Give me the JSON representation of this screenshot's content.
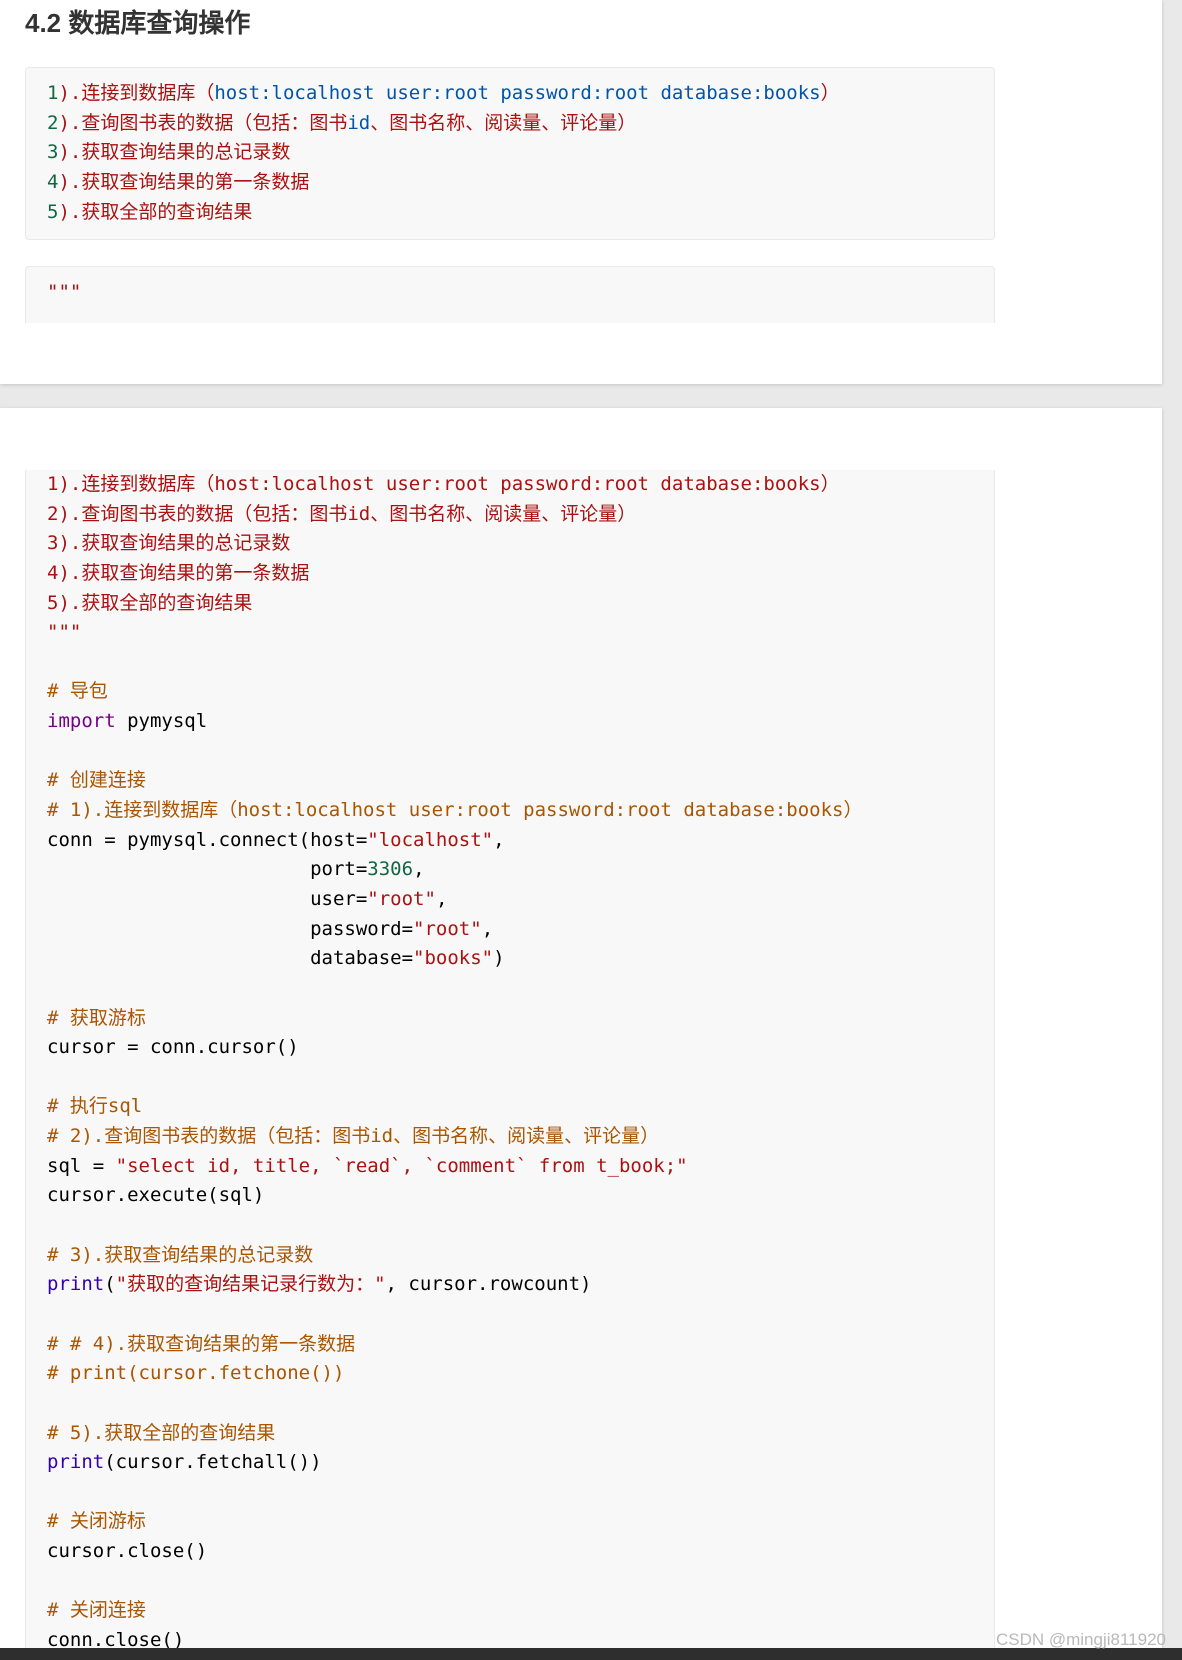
{
  "colors": {
    "number": "#116644",
    "string": "#aa1111",
    "variable2": "#0055aa",
    "comment": "#aa5500",
    "keyword": "#770088",
    "builtin": "#3300aa",
    "text": "#000000"
  },
  "page1": {
    "heading": "4.2 数据库查询操作",
    "requirements_block": [
      [
        {
          "t": "1",
          "c": "number"
        },
        {
          "t": ").连接到数据库（",
          "c": "string"
        },
        {
          "t": "host:localhost user:root password:root database:books",
          "c": "variable2"
        },
        {
          "t": "）",
          "c": "string"
        }
      ],
      [
        {
          "t": "2",
          "c": "number"
        },
        {
          "t": ").查询图书表的数据（包括：图书",
          "c": "string"
        },
        {
          "t": "id",
          "c": "variable2"
        },
        {
          "t": "、图书名称、阅读量、评论量）",
          "c": "string"
        }
      ],
      [
        {
          "t": "3",
          "c": "number"
        },
        {
          "t": ").获取查询结果的总记录数",
          "c": "string"
        }
      ],
      [
        {
          "t": "4",
          "c": "number"
        },
        {
          "t": ").获取查询结果的第一条数据",
          "c": "string"
        }
      ],
      [
        {
          "t": "5",
          "c": "number"
        },
        {
          "t": ").获取全部的查询结果",
          "c": "string"
        }
      ]
    ],
    "docstring_block": [
      [
        {
          "t": "\"\"\"",
          "c": "string"
        }
      ]
    ]
  },
  "page2": {
    "code_block": [
      [
        {
          "t": "1).连接到数据库（host:localhost user:root password:root database:books）",
          "c": "string"
        }
      ],
      [
        {
          "t": "2).查询图书表的数据（包括：图书id、图书名称、阅读量、评论量）",
          "c": "string"
        }
      ],
      [
        {
          "t": "3).获取查询结果的总记录数",
          "c": "string"
        }
      ],
      [
        {
          "t": "4).获取查询结果的第一条数据",
          "c": "string"
        }
      ],
      [
        {
          "t": "5).获取全部的查询结果",
          "c": "string"
        }
      ],
      [
        {
          "t": "\"\"\"",
          "c": "string"
        }
      ],
      [],
      [
        {
          "t": "# 导包",
          "c": "comment"
        }
      ],
      [
        {
          "t": "import",
          "c": "keyword"
        },
        {
          "t": " pymysql",
          "c": "text"
        }
      ],
      [],
      [
        {
          "t": "# 创建连接",
          "c": "comment"
        }
      ],
      [
        {
          "t": "# 1).连接到数据库（host:localhost user:root password:root database:books）",
          "c": "comment"
        }
      ],
      [
        {
          "t": "conn = pymysql.connect(host=",
          "c": "text"
        },
        {
          "t": "\"localhost\"",
          "c": "string"
        },
        {
          "t": ",",
          "c": "text"
        }
      ],
      [
        {
          "t": "                       port=",
          "c": "text"
        },
        {
          "t": "3306",
          "c": "number"
        },
        {
          "t": ",",
          "c": "text"
        }
      ],
      [
        {
          "t": "                       user=",
          "c": "text"
        },
        {
          "t": "\"root\"",
          "c": "string"
        },
        {
          "t": ",",
          "c": "text"
        }
      ],
      [
        {
          "t": "                       password=",
          "c": "text"
        },
        {
          "t": "\"root\"",
          "c": "string"
        },
        {
          "t": ",",
          "c": "text"
        }
      ],
      [
        {
          "t": "                       database=",
          "c": "text"
        },
        {
          "t": "\"books\"",
          "c": "string"
        },
        {
          "t": ")",
          "c": "text"
        }
      ],
      [],
      [
        {
          "t": "# 获取游标",
          "c": "comment"
        }
      ],
      [
        {
          "t": "cursor = conn.cursor()",
          "c": "text"
        }
      ],
      [],
      [
        {
          "t": "# 执行sql",
          "c": "comment"
        }
      ],
      [
        {
          "t": "# 2).查询图书表的数据（包括：图书id、图书名称、阅读量、评论量）",
          "c": "comment"
        }
      ],
      [
        {
          "t": "sql = ",
          "c": "text"
        },
        {
          "t": "\"select id, title, `read`, `comment` from t_book;\"",
          "c": "string"
        }
      ],
      [
        {
          "t": "cursor.execute(sql)",
          "c": "text"
        }
      ],
      [],
      [
        {
          "t": "# 3).获取查询结果的总记录数",
          "c": "comment"
        }
      ],
      [
        {
          "t": "print",
          "c": "builtin"
        },
        {
          "t": "(",
          "c": "text"
        },
        {
          "t": "\"获取的查询结果记录行数为：\"",
          "c": "string"
        },
        {
          "t": ", cursor.rowcount)",
          "c": "text"
        }
      ],
      [],
      [
        {
          "t": "# # 4).获取查询结果的第一条数据",
          "c": "comment"
        }
      ],
      [
        {
          "t": "# print(cursor.fetchone())",
          "c": "comment"
        }
      ],
      [],
      [
        {
          "t": "# 5).获取全部的查询结果",
          "c": "comment"
        }
      ],
      [
        {
          "t": "print",
          "c": "builtin"
        },
        {
          "t": "(cursor.fetchall())",
          "c": "text"
        }
      ],
      [],
      [
        {
          "t": "# 关闭游标",
          "c": "comment"
        }
      ],
      [
        {
          "t": "cursor.close()",
          "c": "text"
        }
      ],
      [],
      [
        {
          "t": "# 关闭连接",
          "c": "comment"
        }
      ],
      [
        {
          "t": "conn.close()",
          "c": "text"
        }
      ]
    ]
  },
  "watermark": "CSDN @mingji811920"
}
